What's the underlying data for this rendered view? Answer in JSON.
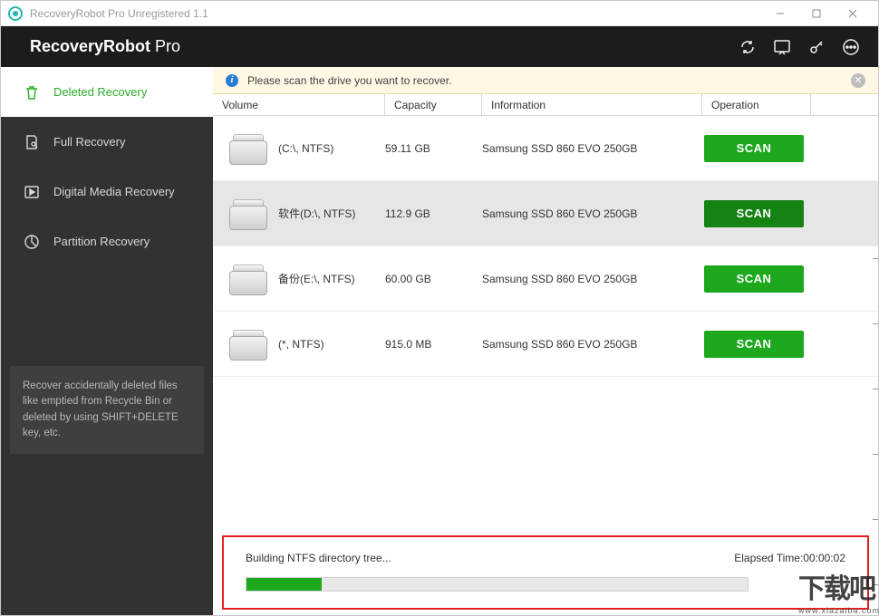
{
  "window": {
    "title": "RecoveryRobot Pro Unregistered 1.1"
  },
  "header": {
    "brand_strong": "RecoveryRobot",
    "brand_light": " Pro"
  },
  "sidebar": {
    "items": [
      {
        "label": "Deleted Recovery"
      },
      {
        "label": "Full Recovery"
      },
      {
        "label": "Digital Media Recovery"
      },
      {
        "label": "Partition Recovery"
      }
    ],
    "tip": "Recover accidentally deleted files like emptied from Recycle Bin or deleted by using SHIFT+DELETE key, etc."
  },
  "notice": {
    "text": "Please scan the drive you want to recover."
  },
  "columns": {
    "volume": "Volume",
    "capacity": "Capacity",
    "information": "Information",
    "operation": "Operation"
  },
  "volumes": [
    {
      "name": "(C:\\, NTFS)",
      "capacity": "59.11 GB",
      "info": "Samsung SSD 860 EVO 250GB",
      "op": "SCAN"
    },
    {
      "name": "软件(D:\\, NTFS)",
      "capacity": "112.9 GB",
      "info": "Samsung SSD 860 EVO 250GB",
      "op": "SCAN"
    },
    {
      "name": "备份(E:\\, NTFS)",
      "capacity": "60.00 GB",
      "info": "Samsung SSD 860 EVO 250GB",
      "op": "SCAN"
    },
    {
      "name": "(*, NTFS)",
      "capacity": "915.0 MB",
      "info": "Samsung SSD 860 EVO 250GB",
      "op": "SCAN"
    }
  ],
  "progress": {
    "status": "Building NTFS directory tree...",
    "elapsed_label": "Elapsed Time: ",
    "elapsed_value": "00:00:02",
    "percent": 15
  },
  "watermark": {
    "big": "下载吧",
    "small": "www.xiazaiba.com"
  }
}
